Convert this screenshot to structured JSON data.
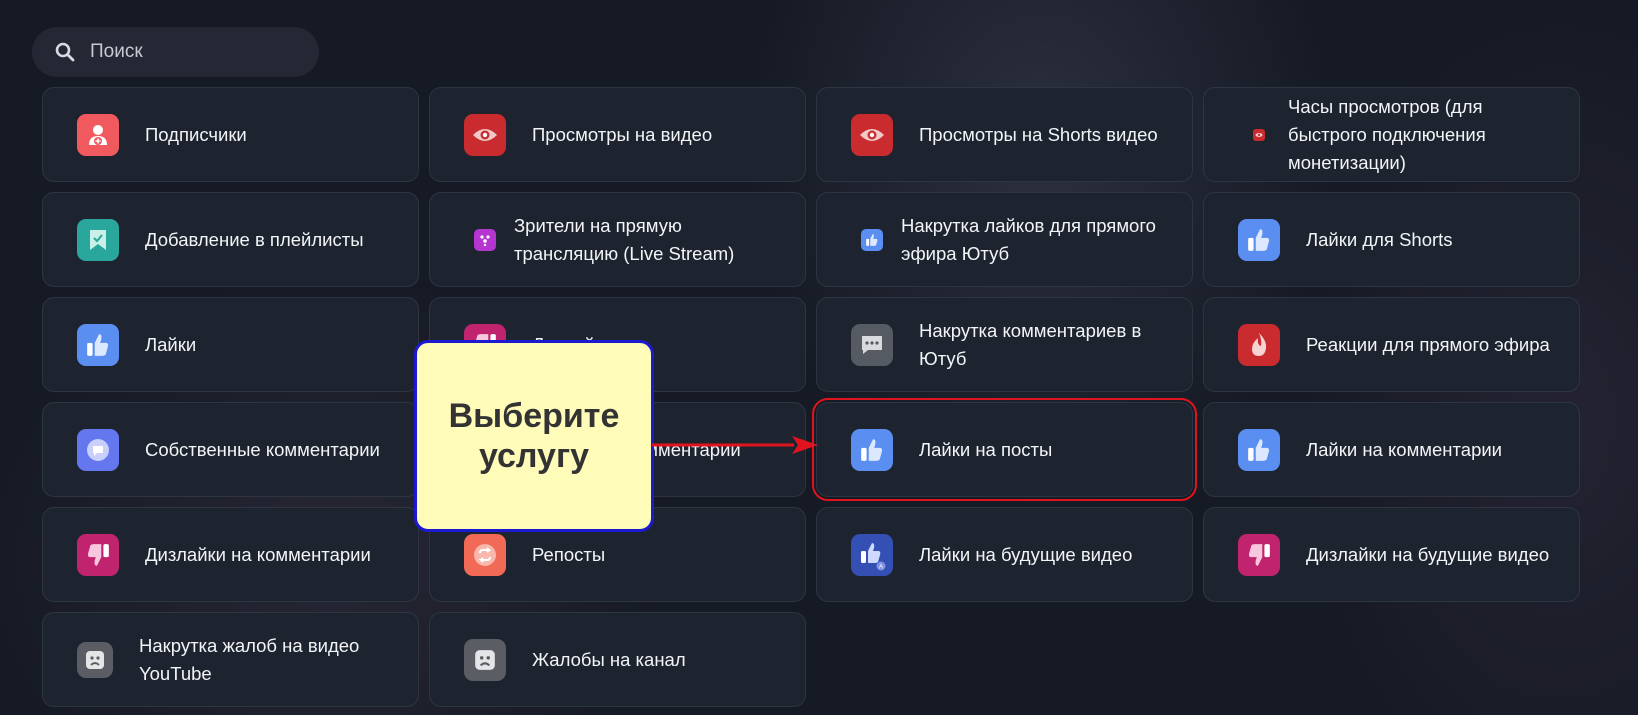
{
  "search": {
    "placeholder": "Поиск",
    "icon": "search-icon"
  },
  "services": [
    {
      "label": "Подписчики",
      "icon": "user-plus-icon",
      "color": "#f05a5e"
    },
    {
      "label": "Просмотры на видео",
      "icon": "eye-icon",
      "color": "#c92b2f"
    },
    {
      "label": "Просмотры на Shorts видео",
      "icon": "eye-icon",
      "color": "#c92b2f"
    },
    {
      "label": "Часы просмотров (для быстрого подключения монетизации)",
      "icon": "eye-icon",
      "color": "#c92b2f"
    },
    {
      "label": "Добавление в плейлисты",
      "icon": "bookmark-icon",
      "color": "#2aa79c"
    },
    {
      "label": "Зрители на прямую трансляцию (Live Stream)",
      "icon": "live-stream-icon",
      "color": "#b535d0"
    },
    {
      "label": "Накрутка лайков для прямого эфира Ютуб",
      "icon": "thumbs-up-icon",
      "color": "#5a8ef0"
    },
    {
      "label": "Лайки для Shorts",
      "icon": "thumbs-up-icon",
      "color": "#5a8ef0"
    },
    {
      "label": "Лайки",
      "icon": "thumbs-up-icon",
      "color": "#5a8ef0"
    },
    {
      "label": "Дизлайки",
      "icon": "thumbs-down-icon",
      "color": "#c0246e"
    },
    {
      "label": "Накрутка комментариев в Ютуб",
      "icon": "chat-icon",
      "color": "#555a63"
    },
    {
      "label": "Реакции для прямого эфира",
      "icon": "flame-icon",
      "color": "#c92b2f"
    },
    {
      "label": "Собственные комментарии",
      "icon": "comment-icon",
      "color": "#6577ee"
    },
    {
      "label": "Ответы на комментарии",
      "icon": "comment-icon",
      "color": "#6577ee"
    },
    {
      "label": "Лайки на посты",
      "icon": "thumbs-up-icon",
      "color": "#5a8ef0",
      "highlighted": true
    },
    {
      "label": "Лайки на комментарии",
      "icon": "thumbs-up-icon",
      "color": "#5a8ef0"
    },
    {
      "label": "Дизлайки на комментарии",
      "icon": "thumbs-down-icon",
      "color": "#c0246e"
    },
    {
      "label": "Репосты",
      "icon": "repost-icon",
      "color": "#f06a55"
    },
    {
      "label": "Лайки на будущие видео",
      "icon": "thumbs-up-auto-icon",
      "color": "#3550b5"
    },
    {
      "label": "Дизлайки на будущие видео",
      "icon": "thumbs-down-icon",
      "color": "#c0246e"
    },
    {
      "label": "Накрутка жалоб на видео YouTube",
      "icon": "sad-face-icon",
      "color": "#5a5d63"
    },
    {
      "label": "Жалобы на канал",
      "icon": "sad-face-icon",
      "color": "#5a5d63"
    }
  ],
  "callout": {
    "line1": "Выберите",
    "line2": "услугу"
  },
  "colors": {
    "background": "#161a24",
    "card": "#1e242f",
    "highlight": "#e0141e",
    "callout_bg": "#fffbb8",
    "callout_border": "#1b1ad0"
  }
}
